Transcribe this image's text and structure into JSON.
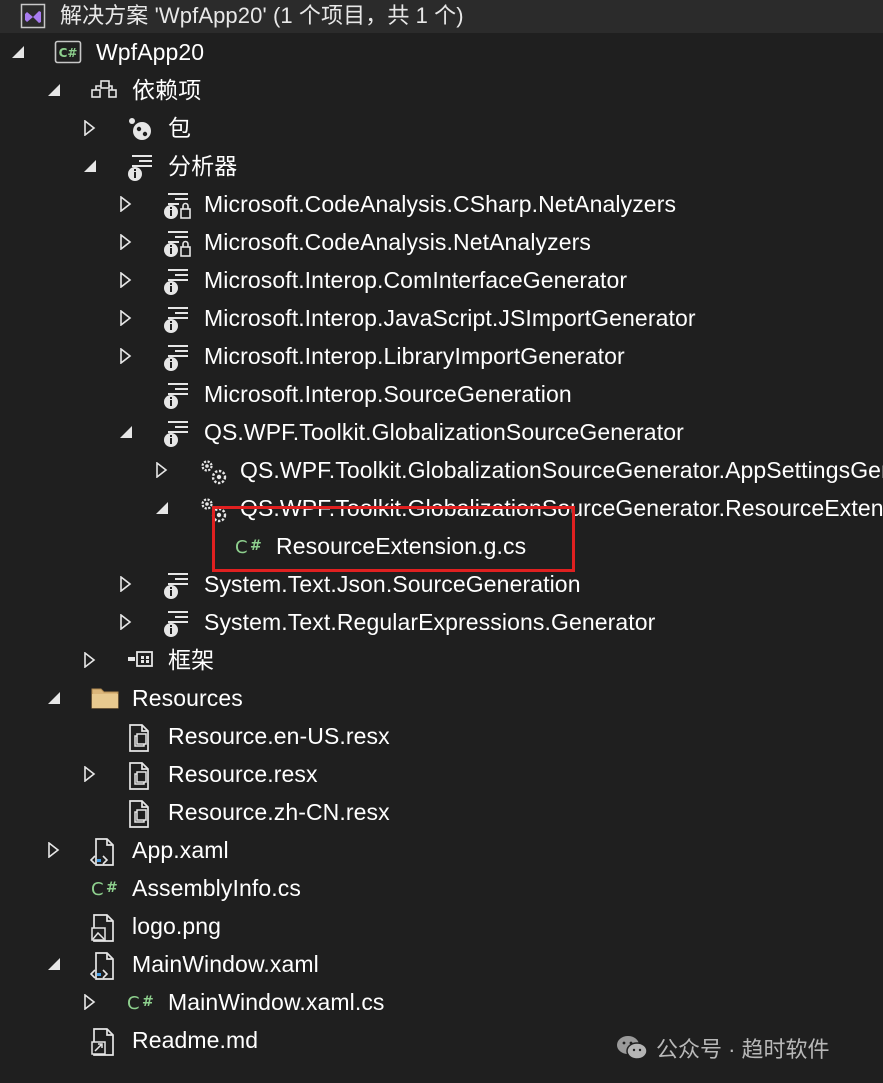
{
  "solution_explorer": {
    "solution_title": "解决方案 'WpfApp20' (1 个项目，共 1 个)",
    "tree": [
      {
        "id": "project-wpfapp20",
        "label": "WpfApp20",
        "depth": 0,
        "expander": "expanded",
        "icon": "csharp-project-icon"
      },
      {
        "id": "dependencies",
        "label": "依赖项",
        "depth": 1,
        "expander": "expanded",
        "icon": "dependencies-icon"
      },
      {
        "id": "packages",
        "label": "包",
        "depth": 2,
        "expander": "collapsed",
        "icon": "package-icon"
      },
      {
        "id": "analyzers",
        "label": "分析器",
        "depth": 2,
        "expander": "expanded",
        "icon": "analyzer-icon"
      },
      {
        "id": "csharp-netanalyzers",
        "label": "Microsoft.CodeAnalysis.CSharp.NetAnalyzers",
        "depth": 3,
        "expander": "collapsed",
        "icon": "analyzer-locked-icon"
      },
      {
        "id": "netanalyzers",
        "label": "Microsoft.CodeAnalysis.NetAnalyzers",
        "depth": 3,
        "expander": "collapsed",
        "icon": "analyzer-locked-icon"
      },
      {
        "id": "cominterface-generator",
        "label": "Microsoft.Interop.ComInterfaceGenerator",
        "depth": 3,
        "expander": "collapsed",
        "icon": "analyzer-icon"
      },
      {
        "id": "jsimport-generator",
        "label": "Microsoft.Interop.JavaScript.JSImportGenerator",
        "depth": 3,
        "expander": "collapsed",
        "icon": "analyzer-icon"
      },
      {
        "id": "libraryimport-generator",
        "label": "Microsoft.Interop.LibraryImportGenerator",
        "depth": 3,
        "expander": "collapsed",
        "icon": "analyzer-icon"
      },
      {
        "id": "interop-sourcegeneration",
        "label": "Microsoft.Interop.SourceGeneration",
        "depth": 3,
        "expander": "none",
        "icon": "analyzer-icon"
      },
      {
        "id": "qs-globalization-generator",
        "label": "QS.WPF.Toolkit.GlobalizationSourceGenerator",
        "depth": 3,
        "expander": "expanded",
        "icon": "analyzer-icon"
      },
      {
        "id": "qs-appsettings-generator",
        "label": "QS.WPF.Toolkit.GlobalizationSourceGenerator.AppSettingsGenerator",
        "depth": 4,
        "expander": "collapsed",
        "icon": "gears-icon"
      },
      {
        "id": "qs-resource-generator",
        "label": "QS.WPF.Toolkit.GlobalizationSourceGenerator.ResourceExtensionGenerator",
        "depth": 4,
        "expander": "expanded",
        "icon": "gears-icon"
      },
      {
        "id": "resource-extension-g-cs",
        "label": "ResourceExtension.g.cs",
        "depth": 5,
        "expander": "none",
        "icon": "csharp-file-icon"
      },
      {
        "id": "text-json-sourcegeneration",
        "label": "System.Text.Json.SourceGeneration",
        "depth": 3,
        "expander": "collapsed",
        "icon": "analyzer-icon"
      },
      {
        "id": "regularexpressions-generator",
        "label": "System.Text.RegularExpressions.Generator",
        "depth": 3,
        "expander": "collapsed",
        "icon": "analyzer-icon"
      },
      {
        "id": "frameworks",
        "label": "框架",
        "depth": 2,
        "expander": "collapsed",
        "icon": "framework-icon"
      },
      {
        "id": "resources-folder",
        "label": "Resources",
        "depth": 1,
        "expander": "expanded",
        "icon": "folder-icon"
      },
      {
        "id": "resource-en-us",
        "label": "Resource.en-US.resx",
        "depth": 2,
        "expander": "none",
        "icon": "resx-file-icon"
      },
      {
        "id": "resource-resx",
        "label": "Resource.resx",
        "depth": 2,
        "expander": "collapsed",
        "icon": "resx-file-icon"
      },
      {
        "id": "resource-zh-cn",
        "label": "Resource.zh-CN.resx",
        "depth": 2,
        "expander": "none",
        "icon": "resx-file-icon"
      },
      {
        "id": "app-xaml",
        "label": "App.xaml",
        "depth": 1,
        "expander": "collapsed",
        "icon": "xaml-file-icon"
      },
      {
        "id": "assemblyinfo-cs",
        "label": "AssemblyInfo.cs",
        "depth": 1,
        "expander": "none",
        "icon": "csharp-file-icon"
      },
      {
        "id": "logo-png",
        "label": "logo.png",
        "depth": 1,
        "expander": "none",
        "icon": "image-file-icon"
      },
      {
        "id": "mainwindow-xaml",
        "label": "MainWindow.xaml",
        "depth": 1,
        "expander": "expanded",
        "icon": "xaml-file-icon"
      },
      {
        "id": "mainwindow-xaml-cs",
        "label": "MainWindow.xaml.cs",
        "depth": 2,
        "expander": "collapsed",
        "icon": "csharp-file-icon"
      },
      {
        "id": "readme-md",
        "label": "Readme.md",
        "depth": 1,
        "expander": "none",
        "icon": "markdown-file-icon"
      }
    ],
    "highlighted_item": "resource-extension-g-cs"
  },
  "watermark": {
    "text": "公众号 · 趋时软件",
    "icon": "wechat-icon"
  },
  "colors": {
    "background": "#1f1f1f",
    "solution_bar": "#2b2b2b",
    "text": "#ffffff",
    "csharp_green": "#8ed08e",
    "folder_tan": "#dcb67a",
    "vs_purple": "#a87cf0",
    "highlight_red": "#e02020"
  }
}
